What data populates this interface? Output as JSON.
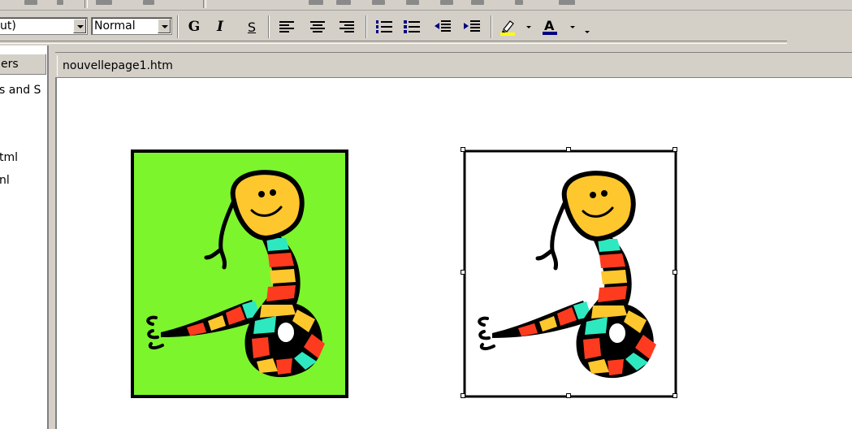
{
  "toolbar": {
    "font_value": "ut)",
    "style_value": "Normal",
    "bold_label": "G",
    "italic_label": "I",
    "strike_label": "S"
  },
  "colors": {
    "highlight": "#ffff00",
    "font_color": "#000080",
    "picture_bg_left": "#7cf52c",
    "picture_bg_right": "#ffffff"
  },
  "sidebar": {
    "header": "ers",
    "items": [
      {
        "label": "s and S"
      },
      {
        "label": "tml"
      },
      {
        "label": "nl"
      }
    ]
  },
  "document": {
    "tab_label": "nouvellepage1.htm"
  },
  "pictures": [
    {
      "name": "snake clip art",
      "background": "green",
      "selected": false
    },
    {
      "name": "snake clip art",
      "background": "transparent",
      "selected": true
    }
  ]
}
